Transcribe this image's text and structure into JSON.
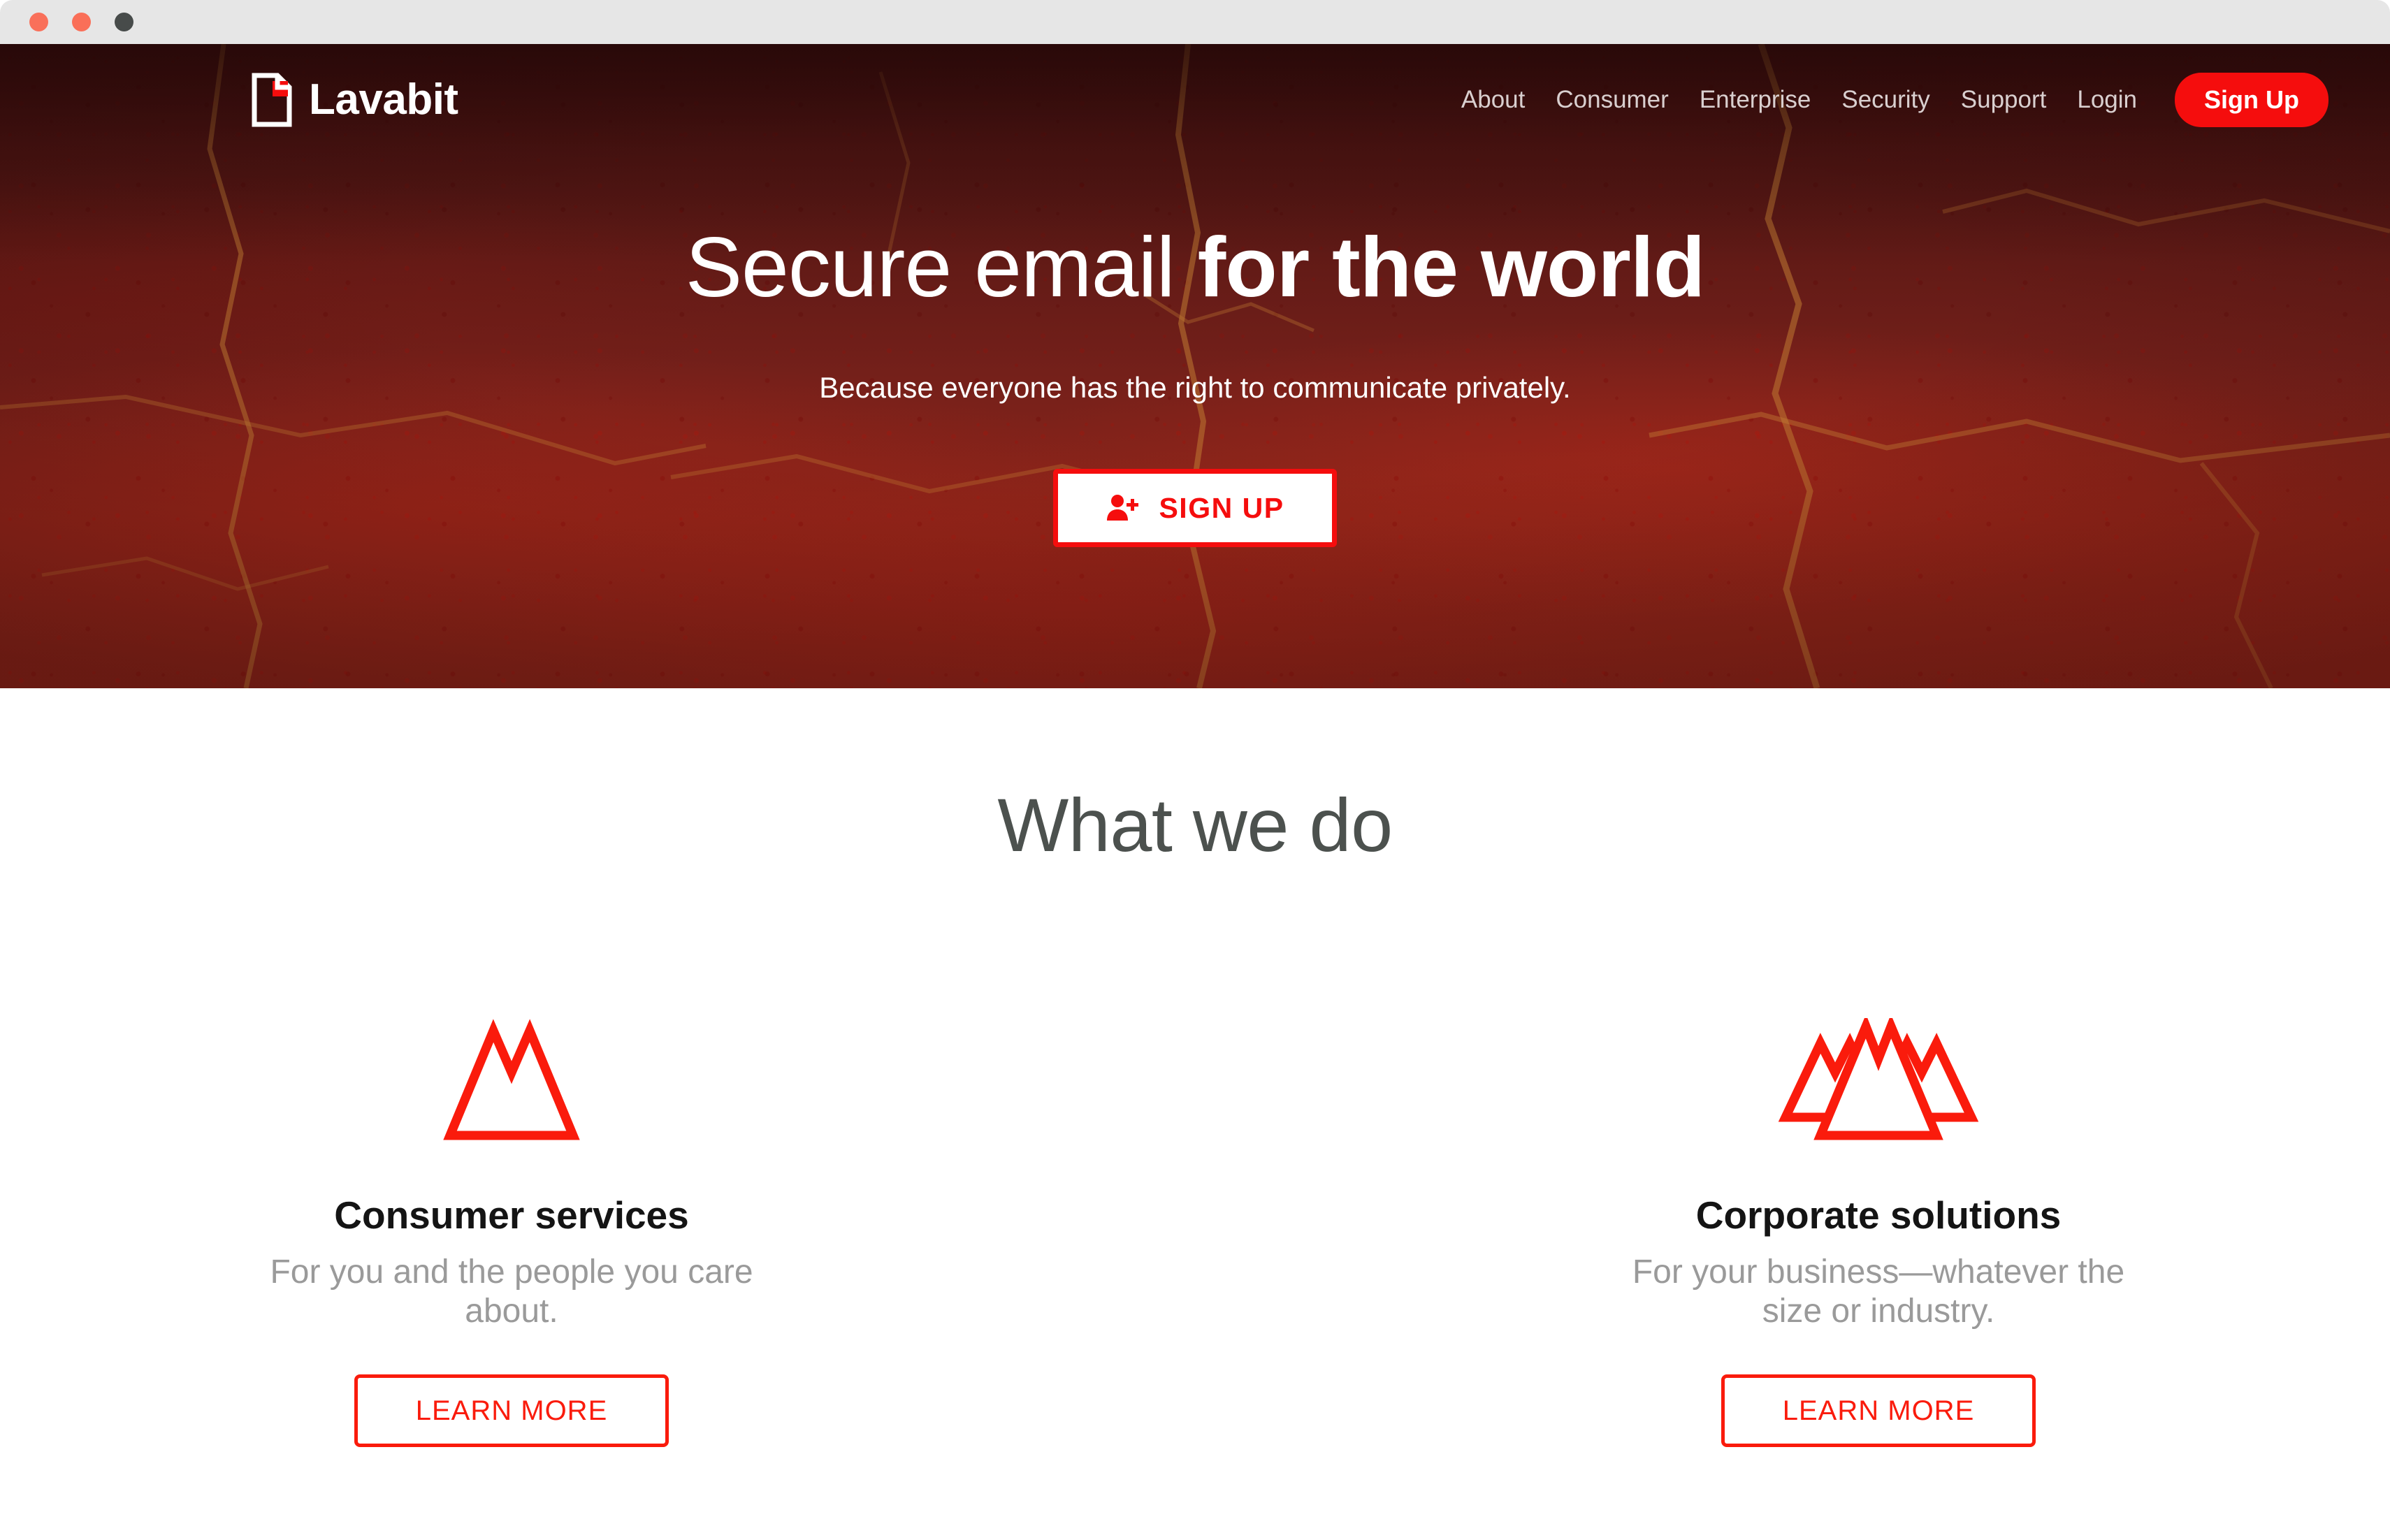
{
  "window": {
    "traffic_lights": [
      "close",
      "minimize",
      "zoom"
    ],
    "colors": {
      "titlebar": "#e6e6e6",
      "close": "#f9705a",
      "minimize": "#fa6f58",
      "zoom": "#474b4a"
    }
  },
  "brand": {
    "name": "Lavabit",
    "mark_icon": "document-page-icon",
    "accent": "#f50d0d"
  },
  "nav": {
    "links": [
      {
        "label": "About"
      },
      {
        "label": "Consumer"
      },
      {
        "label": "Enterprise"
      },
      {
        "label": "Security"
      },
      {
        "label": "Support"
      },
      {
        "label": "Login"
      }
    ],
    "signup_label": "Sign Up"
  },
  "hero": {
    "title_light": "Secure email ",
    "title_bold": "for the world",
    "subtitle": "Because everyone has the right to communicate privately.",
    "cta_label": "SIGN UP",
    "cta_icon": "user-add-icon",
    "colors": {
      "background_top": "#4a1211",
      "background_bottom": "#8b2418",
      "accent": "#f50d0d",
      "text": "#ffffff"
    }
  },
  "what_we_do": {
    "heading": "What we do",
    "heading_color": "#4c514e",
    "cards": [
      {
        "icon": "single-mountain-icon",
        "title": "Consumer services",
        "text": "For you and the people you care about.",
        "button_label": "LEARN MORE"
      },
      {
        "icon": "triple-mountain-icon",
        "title": "Corporate solutions",
        "text": "For your business—whatever the size or industry.",
        "button_label": "LEARN MORE"
      }
    ],
    "accent": "#fa1b0c",
    "title_color": "#141414",
    "text_color": "#9a9a9a"
  }
}
